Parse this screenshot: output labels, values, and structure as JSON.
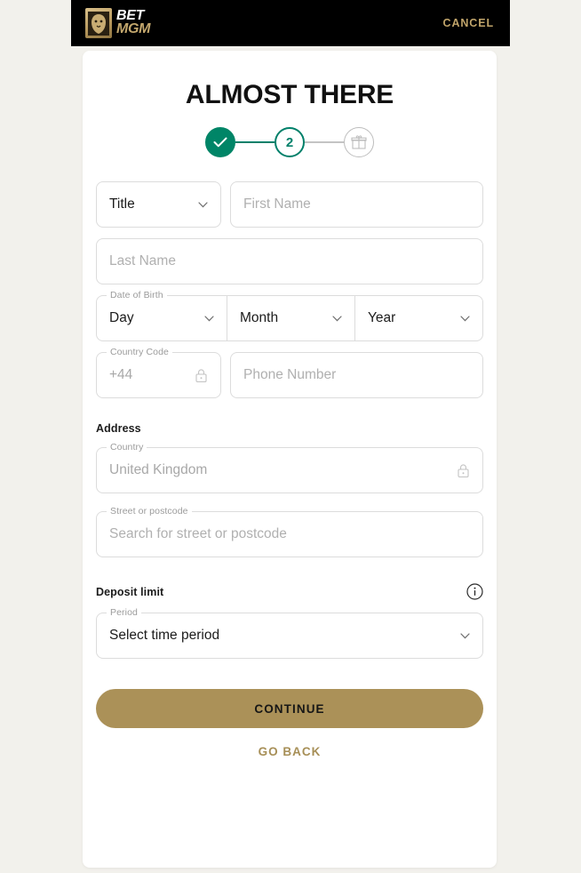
{
  "topbar": {
    "logo_line1": "BET",
    "logo_line2": "MGM",
    "cancel_label": "CANCEL"
  },
  "card": {
    "title": "ALMOST THERE"
  },
  "stepper": {
    "steps": [
      {
        "id": "step-1",
        "state": "done",
        "label": ""
      },
      {
        "id": "step-2",
        "state": "current",
        "label": "2"
      },
      {
        "id": "step-3",
        "state": "upcoming",
        "label": ""
      }
    ]
  },
  "form": {
    "title_select": {
      "legend": "",
      "value": "Title"
    },
    "first_name": {
      "placeholder": "First Name",
      "value": ""
    },
    "last_name": {
      "placeholder": "Last Name",
      "value": ""
    },
    "date_of_birth": {
      "legend": "Date of Birth",
      "day": "Day",
      "month": "Month",
      "year": "Year"
    },
    "country_code": {
      "legend": "Country Code",
      "value": "+44"
    },
    "phone_number": {
      "placeholder": "Phone Number",
      "value": ""
    },
    "address_heading": "Address",
    "country": {
      "legend": "Country",
      "value": "United Kingdom"
    },
    "street": {
      "legend": "Street or postcode",
      "placeholder": "Search for street or postcode",
      "value": ""
    },
    "deposit_limit_heading": "Deposit limit",
    "period": {
      "legend": "Period",
      "value": "Select time period"
    }
  },
  "actions": {
    "continue_label": "CONTINUE",
    "go_back_label": "GO BACK"
  },
  "colors": {
    "page_background": "#f2f1ec",
    "topbar_background": "#000000",
    "brand_gold": "#ab9158",
    "accent_green": "#008567",
    "border_grey": "#dcdcdc",
    "placeholder_grey": "#b0b0b0"
  }
}
